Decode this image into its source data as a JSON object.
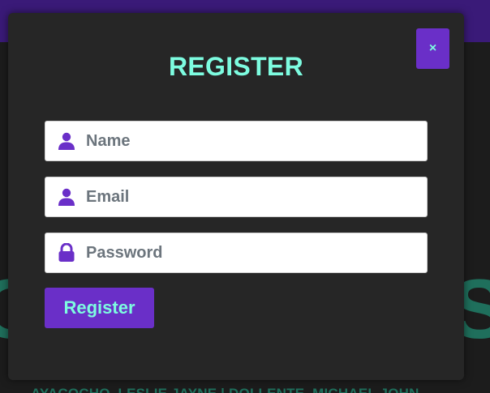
{
  "background": {
    "heading_left": "C",
    "heading_right": "S",
    "credits": "AYACOCHO, LESLIE JAYNE | DOLLENTE, MICHAEL JOHN"
  },
  "modal": {
    "close_label": "×",
    "title": "REGISTER",
    "fields": {
      "name": {
        "placeholder": "Name",
        "icon": "user-icon"
      },
      "email": {
        "placeholder": "Email",
        "icon": "user-icon"
      },
      "password": {
        "placeholder": "Password",
        "icon": "lock-icon"
      }
    },
    "submit_label": "Register"
  },
  "colors": {
    "accent": "#6a2fc8",
    "text_accent": "#7dfce0",
    "modal_bg": "#262626",
    "top_bar": "#3a1a78"
  }
}
